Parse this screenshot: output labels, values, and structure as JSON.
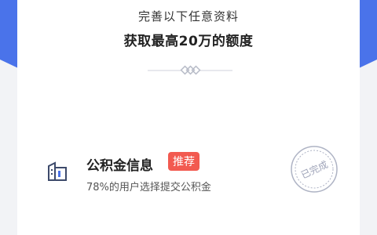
{
  "header": {
    "subtitle": "完善以下任意资料",
    "title": "获取最高20万的额度"
  },
  "item": {
    "title": "公积金信息",
    "badge": "推荐",
    "description": "78%的用户选择提交公积金",
    "status": "已完成",
    "icon": "building-icon"
  },
  "colors": {
    "accent": "#4a73ea",
    "badge": "#f25a50",
    "stamp": "#9ea3b8"
  }
}
